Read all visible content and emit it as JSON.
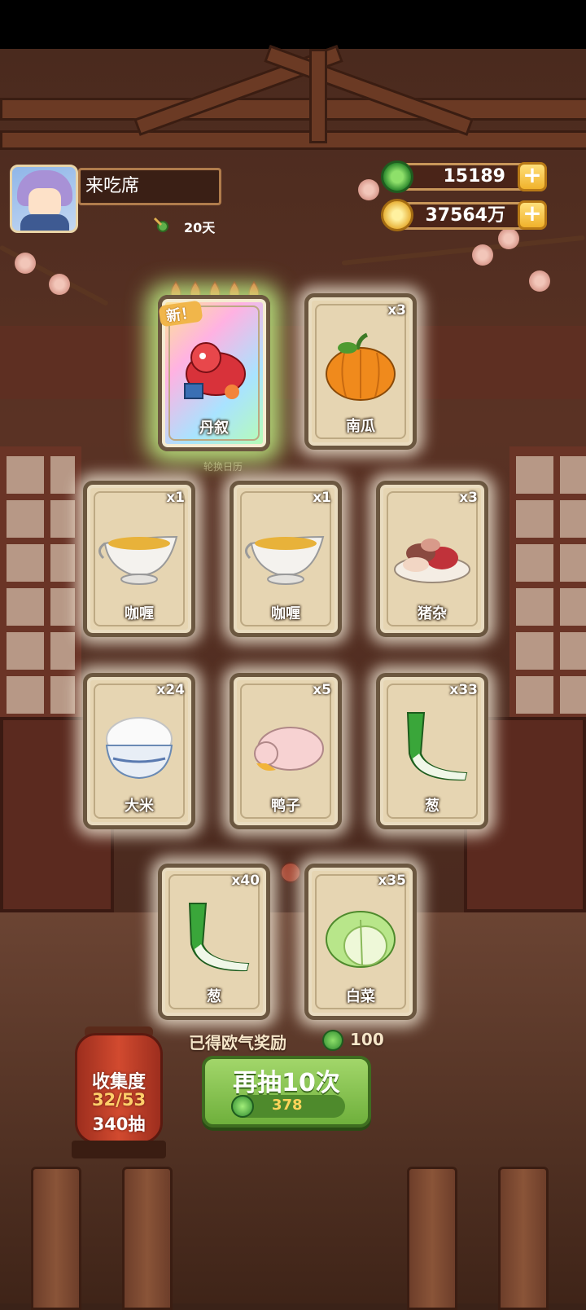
{
  "player": {
    "name": "来吃席",
    "days": "20天"
  },
  "currency": {
    "jade": "15189",
    "coins": "37564万",
    "plus": "+"
  },
  "cards": [
    {
      "name": "丹叙",
      "count": "",
      "new": true,
      "new_label": "新！",
      "stars": 5
    },
    {
      "name": "南瓜",
      "count": "x3"
    },
    {
      "name": "咖喱",
      "count": "x1"
    },
    {
      "name": "咖喱",
      "count": "x1"
    },
    {
      "name": "猪杂",
      "count": "x3"
    },
    {
      "name": "大米",
      "count": "x24"
    },
    {
      "name": "鸭子",
      "count": "x5"
    },
    {
      "name": "葱",
      "count": "x33"
    },
    {
      "name": "葱",
      "count": "x40"
    },
    {
      "name": "白菜",
      "count": "x35"
    }
  ],
  "background": {
    "calendar_text": "轮换日历"
  },
  "bottom": {
    "reward_label": "已得欧气奖励",
    "reward_value": "100",
    "collection_label": "收集度",
    "collection_value": "32/53",
    "draw_count": "340抽",
    "draw_button": "再抽10次",
    "draw_cost": "378"
  },
  "colors": {
    "accent_green": "#6fb03c",
    "gold": "#f0b22c",
    "lantern_red": "#d24a2f"
  }
}
